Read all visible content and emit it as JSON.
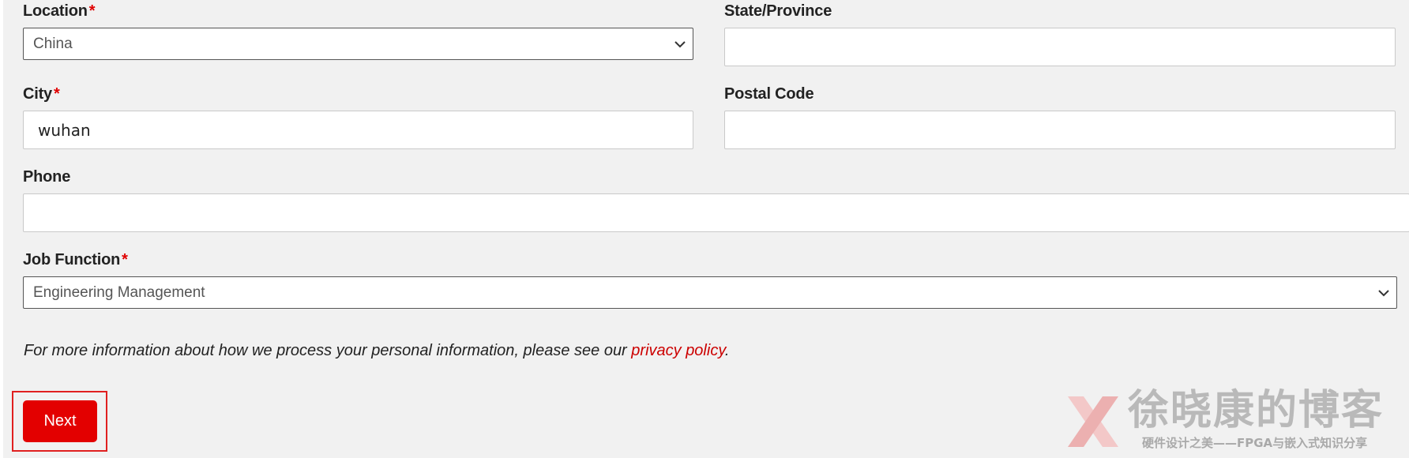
{
  "form": {
    "location": {
      "label": "Location",
      "required_mark": "*",
      "value": "China"
    },
    "state": {
      "label": "State/Province",
      "value": ""
    },
    "city": {
      "label": "City",
      "required_mark": "*",
      "value": "wuhan"
    },
    "postal_code": {
      "label": "Postal Code",
      "value": ""
    },
    "phone": {
      "label": "Phone",
      "value": ""
    },
    "job_function": {
      "label": "Job Function",
      "required_mark": "*",
      "value": "Engineering Management"
    },
    "privacy": {
      "text": "For more information about how we process your personal information, please see our ",
      "link_text": "privacy policy",
      "end": "."
    },
    "next_label": "Next"
  },
  "watermark": {
    "title": "徐晓康的博客",
    "subtitle": "硬件设计之美——FPGA与嵌入式知识分享"
  },
  "colors": {
    "accent": "#e30000",
    "required": "#e00000",
    "link": "#cc0000",
    "panel_bg": "#f1f1f1"
  },
  "icons": {
    "select_chevron": "chevron-down-icon",
    "watermark_logo": "x-logo-icon"
  }
}
